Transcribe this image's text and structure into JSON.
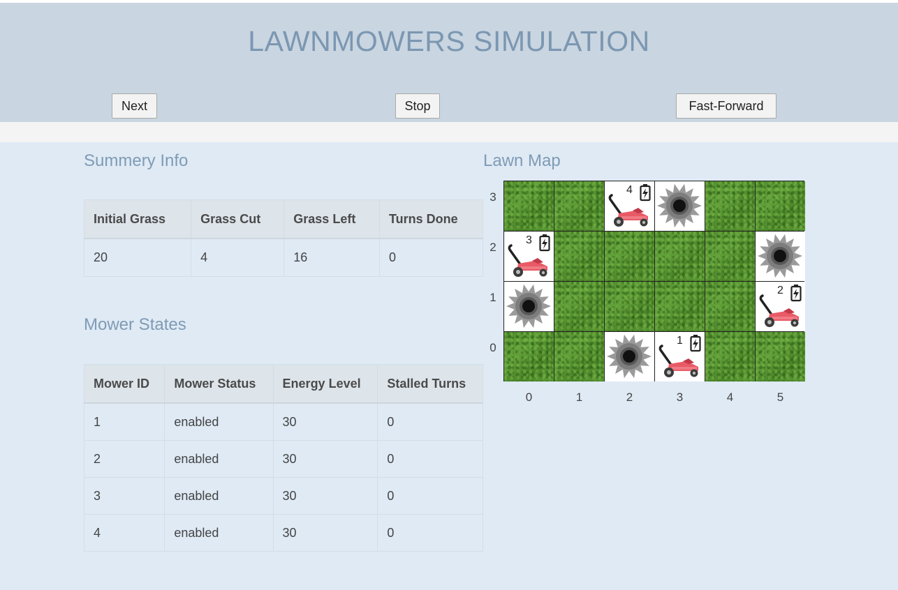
{
  "title": "LAWNMOWERS SIMULATION",
  "controls": {
    "next_label": "Next",
    "stop_label": "Stop",
    "fast_forward_label": "Fast-Forward"
  },
  "summary": {
    "heading": "Summery Info",
    "columns": [
      "Initial Grass",
      "Grass Cut",
      "Grass Left",
      "Turns Done"
    ],
    "values": [
      "20",
      "4",
      "16",
      "0"
    ]
  },
  "mower_states": {
    "heading": "Mower States",
    "columns": [
      "Mower ID",
      "Mower Status",
      "Energy Level",
      "Stalled Turns"
    ],
    "rows": [
      [
        "1",
        "enabled",
        "30",
        "0"
      ],
      [
        "2",
        "enabled",
        "30",
        "0"
      ],
      [
        "3",
        "enabled",
        "30",
        "0"
      ],
      [
        "4",
        "enabled",
        "30",
        "0"
      ]
    ]
  },
  "lawn_map": {
    "heading": "Lawn Map",
    "row_labels": [
      "3",
      "2",
      "1",
      "0"
    ],
    "col_labels": [
      "0",
      "1",
      "2",
      "3",
      "4",
      "5"
    ],
    "grid": [
      [
        "grass",
        "grass",
        "mower:4",
        "crater",
        "grass",
        "grass"
      ],
      [
        "mower:3",
        "grass",
        "grass",
        "grass",
        "grass",
        "crater"
      ],
      [
        "crater",
        "grass",
        "grass",
        "grass",
        "grass",
        "mower:2"
      ],
      [
        "grass",
        "grass",
        "crater",
        "mower:1",
        "grass",
        "grass"
      ]
    ],
    "icons": {
      "mower": "lawnmower-icon",
      "battery": "battery-charging-icon",
      "crater": "crater-icon"
    }
  }
}
